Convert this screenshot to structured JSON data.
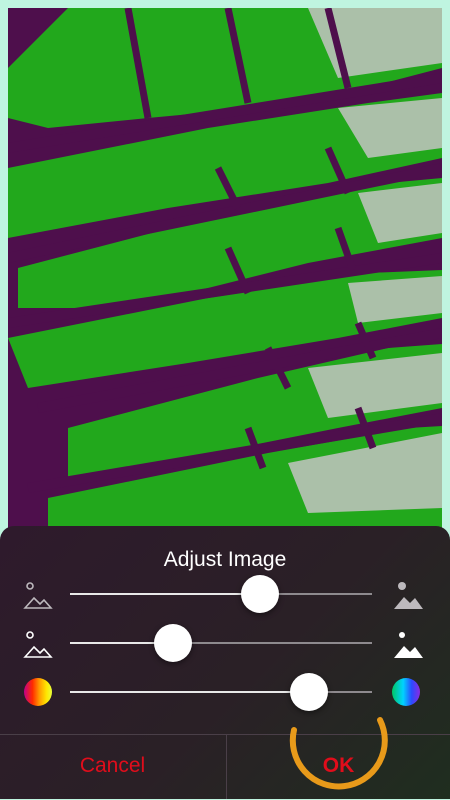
{
  "dialog": {
    "title": "Adjust Image",
    "cancel_label": "Cancel",
    "ok_label": "OK"
  },
  "sliders": [
    {
      "name": "brightness",
      "left_icon": "landscape-small-outline-icon",
      "right_icon": "landscape-large-filled-icon",
      "value": 0.63
    },
    {
      "name": "contrast",
      "left_icon": "landscape-outline-icon",
      "right_icon": "landscape-filled-icon",
      "value": 0.34
    },
    {
      "name": "saturation",
      "left_icon": "color-wheel-warm-icon",
      "right_icon": "color-wheel-cool-icon",
      "value": 0.79
    }
  ],
  "colors": {
    "photo_base": "#4e0f4c",
    "photo_green": "#22a81c",
    "accent_red": "#e00d1b",
    "highlight_ring": "#e89a1a",
    "page_background": "#bff5e0"
  }
}
